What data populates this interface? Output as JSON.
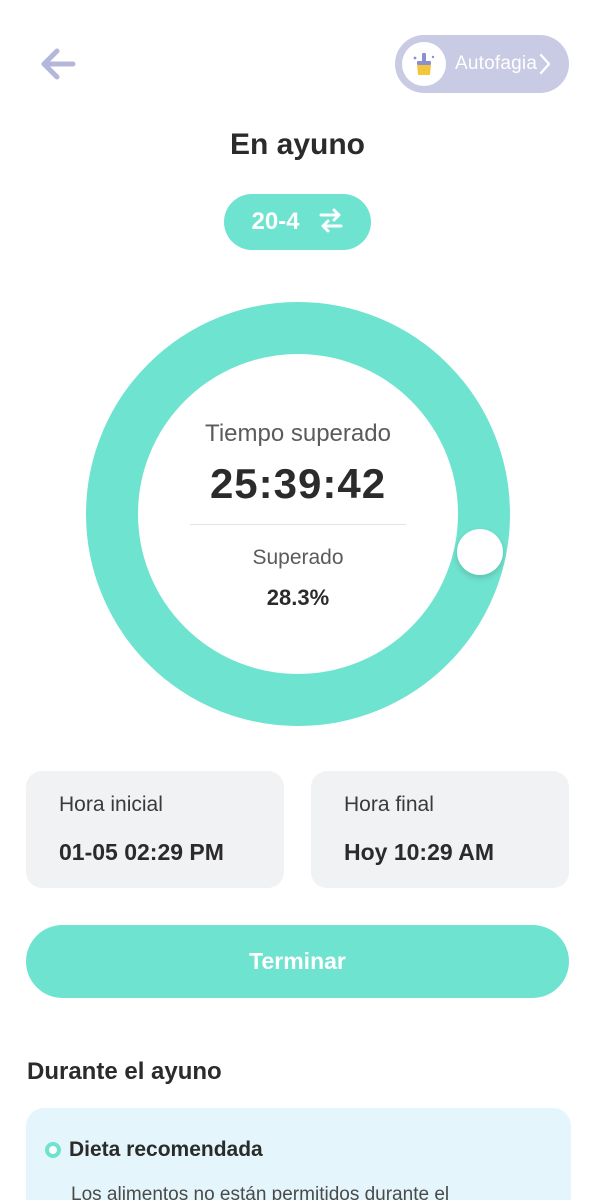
{
  "header": {
    "back_icon": "arrow-left-icon",
    "autofagia": {
      "label": "Autofagia",
      "icon": "broom-icon",
      "chevron": "chevron-right-icon"
    }
  },
  "title": "En ayuno",
  "plan": {
    "label": "20-4",
    "icon": "swap-arrows-icon"
  },
  "progress": {
    "label_elapsed": "Tiempo superado",
    "elapsed_time": "25:39:42",
    "label_status": "Superado",
    "percent_text": "28.3%",
    "ring_fraction": 1.0,
    "knob_fraction": 0.283
  },
  "times": {
    "start": {
      "label": "Hora inicial",
      "value": "01-05 02:29 PM"
    },
    "end": {
      "label": "Hora final",
      "value": "Hoy 10:29 AM"
    }
  },
  "finish_button": {
    "label": "Terminar"
  },
  "section": {
    "title": "Durante el ayuno",
    "tip": {
      "title": "Dieta recomendada",
      "text": "Los alimentos no están permitidos durante el"
    }
  },
  "colors": {
    "accent": "#6ee3cf",
    "pill_bg": "#c8cbe3",
    "card_bg": "#f1f2f4",
    "tip_bg": "#e4f6fb",
    "text": "#2b2b2b"
  }
}
